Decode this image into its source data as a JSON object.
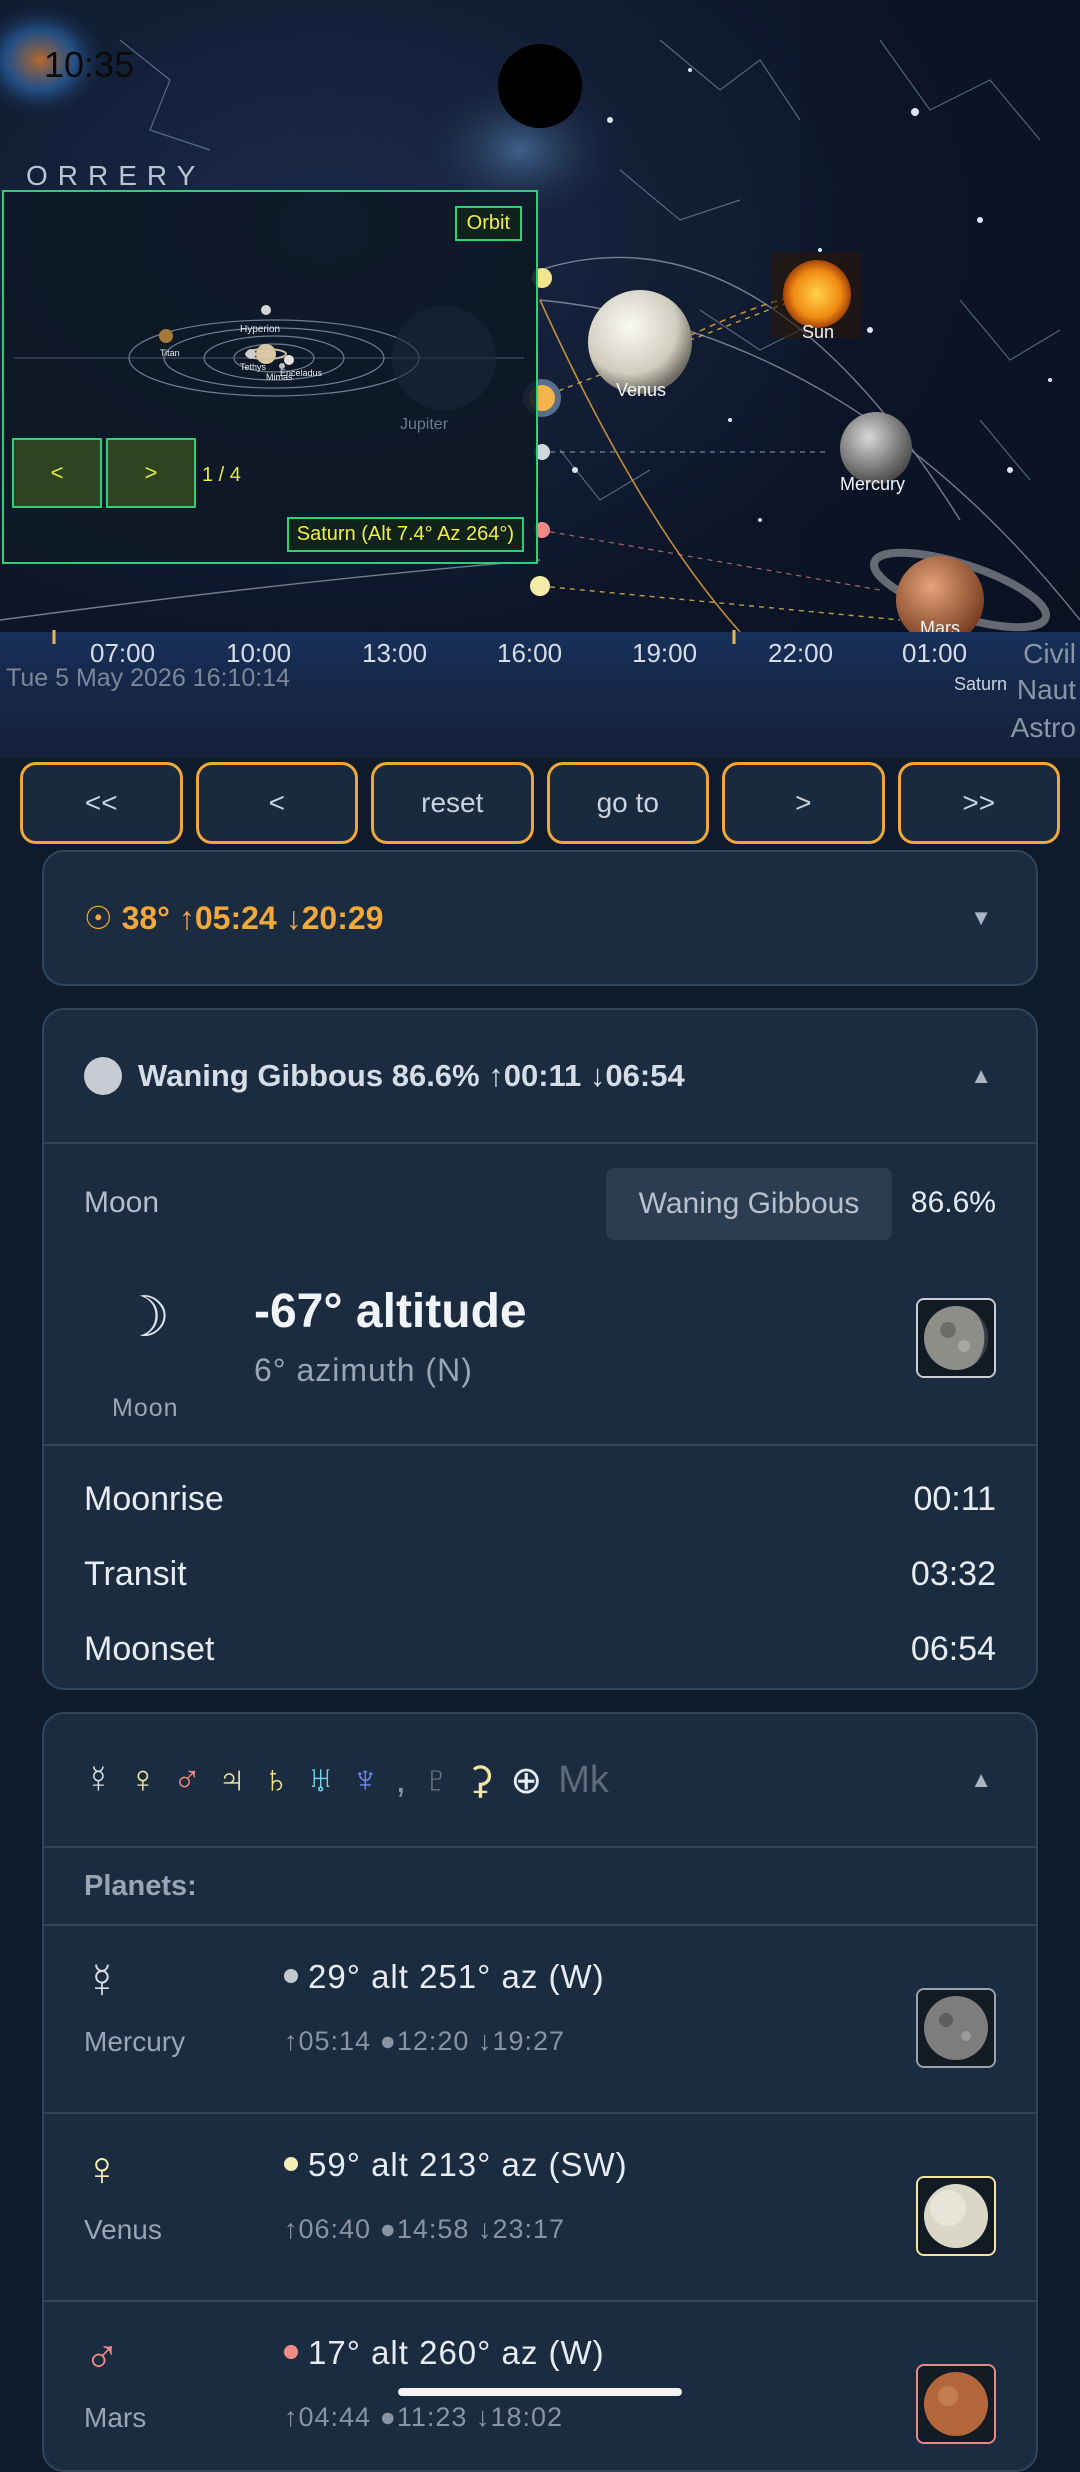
{
  "status_bar": {
    "time": "10:35"
  },
  "app": {
    "title": "ORRERY"
  },
  "orrery_panel": {
    "orbit_button": "Orbit",
    "prev_label": "<",
    "next_label": ">",
    "page_counter": "1 / 4",
    "readout": "Saturn  (Alt 7.4°  Az 264°)",
    "moon_labels": [
      "Hyperion",
      "Titan",
      "Tethys",
      "Mimas",
      "Enceladus"
    ],
    "faded_label": "Jupiter"
  },
  "sky": {
    "body_labels": {
      "venus": "Venus",
      "sun": "Sun",
      "mercury": "Mercury",
      "mars": "Mars",
      "saturn": "Saturn"
    }
  },
  "timeline": {
    "ticks": [
      "07:00",
      "10:00",
      "13:00",
      "16:00",
      "19:00",
      "22:00",
      "01:00"
    ],
    "datetime": "Tue 5 May 2026  16:10:14",
    "twilight": [
      "Civil",
      "Naut",
      "Astro"
    ]
  },
  "controls": [
    "<<",
    "<",
    "reset",
    "go to",
    ">",
    ">>"
  ],
  "sun_card": {
    "summary": "☉ 38°  ↑05:24  ↓20:29",
    "chevron": "▼"
  },
  "moon_card": {
    "summary": "Waning Gibbous 86.6%  ↑00:11 ↓06:54",
    "chevron": "▲",
    "label": "Moon",
    "phase_chip": "Waning Gibbous",
    "illumination": "86.6%",
    "glyph": "☽",
    "glyph_caption": "Moon",
    "altitude": "-67° altitude",
    "azimuth": "6° azimuth  (N)",
    "events": [
      {
        "name": "Moonrise",
        "time": "00:11"
      },
      {
        "name": "Transit",
        "time": "03:32"
      },
      {
        "name": "Moonset",
        "time": "06:54"
      }
    ]
  },
  "planets_card": {
    "glyphs": [
      "☿",
      "♀",
      "♂",
      "♃",
      "♄",
      "♅",
      "♆",
      ",",
      "♇",
      "⚳",
      "⊕",
      "Mk"
    ],
    "glyph_colors": [
      "#d8dde3",
      "#f3ebb0",
      "#f08b87",
      "#f0e6a8",
      "#f1e18a",
      "#6fd6e8",
      "#6b8cf2",
      "#8d97a5",
      "#6a7484",
      "#f0e6a8",
      "#e6ecf3",
      "#5f6b7b"
    ],
    "chevron": "▲",
    "section_label": "Planets:",
    "planets": [
      {
        "glyph": "☿",
        "name": "Mercury",
        "color": "#c3c8cf",
        "position": "29° alt   251° az  (W)",
        "times": "↑05:14  ●12:20  ↓19:27"
      },
      {
        "glyph": "♀",
        "name": "Venus",
        "color": "#f4eeb8",
        "position": "59° alt   213° az  (SW)",
        "times": "↑06:40  ●14:58  ↓23:17"
      },
      {
        "glyph": "♂",
        "name": "Mars",
        "color": "#ef8a86",
        "position": "17° alt   260° az  (W)",
        "times": "↑04:44  ●11:23  ↓18:02"
      }
    ]
  }
}
